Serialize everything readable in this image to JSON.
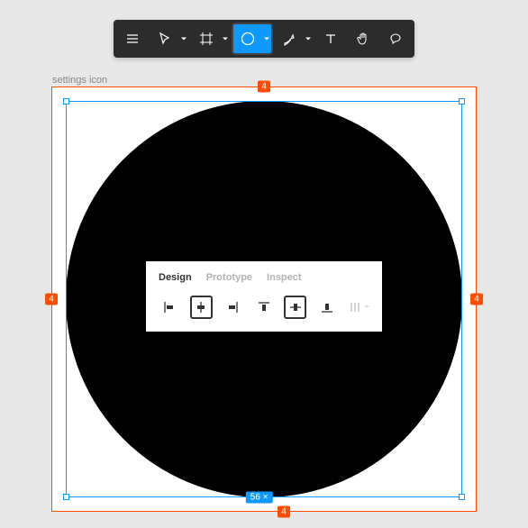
{
  "toolbar": {
    "tools": [
      {
        "name": "menu"
      },
      {
        "name": "move",
        "hasChevron": true
      },
      {
        "name": "frame",
        "hasChevron": true
      },
      {
        "name": "shape",
        "hasChevron": true,
        "active": true
      },
      {
        "name": "pen",
        "hasChevron": true
      },
      {
        "name": "text"
      },
      {
        "name": "hand"
      },
      {
        "name": "comment"
      }
    ]
  },
  "canvas": {
    "layer_label": "settings icon",
    "dim_top": "4",
    "dim_right": "4",
    "dim_bottom": "4",
    "dim_left": "4",
    "selection_size": "56 ×",
    "shape_fill": "#000000",
    "accent": "#0d99ff",
    "spacing_color": "#ff4d00"
  },
  "panel": {
    "tabs": [
      {
        "label": "Design",
        "active": true
      },
      {
        "label": "Prototype",
        "active": false
      },
      {
        "label": "Inspect",
        "active": false
      }
    ],
    "align": [
      {
        "name": "align-left"
      },
      {
        "name": "align-hcenter",
        "highlighted": true
      },
      {
        "name": "align-right"
      },
      {
        "name": "align-top"
      },
      {
        "name": "align-vcenter",
        "highlighted": true
      },
      {
        "name": "align-bottom"
      },
      {
        "name": "tidy-up",
        "disabled": true,
        "hasChevron": true
      }
    ]
  }
}
